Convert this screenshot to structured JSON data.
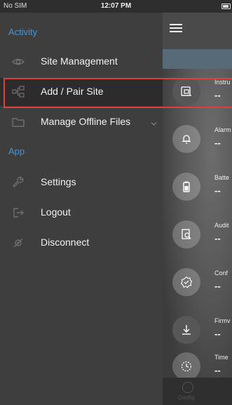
{
  "status_bar": {
    "carrier": "No SIM",
    "time": "12:07 PM"
  },
  "drawer": {
    "sections": [
      {
        "title": "Activity",
        "items": [
          {
            "label": "Site Management",
            "icon": "eye-icon"
          },
          {
            "label": "Add / Pair Site",
            "icon": "pair-site-icon"
          },
          {
            "label": "Manage Offline Files",
            "icon": "folder-icon"
          }
        ]
      },
      {
        "title": "App",
        "items": [
          {
            "label": "Settings",
            "icon": "wrench-icon"
          },
          {
            "label": "Logout",
            "icon": "logout-icon"
          },
          {
            "label": "Disconnect",
            "icon": "disconnect-icon"
          }
        ]
      }
    ]
  },
  "main": {
    "tiles": [
      {
        "label": "Instru",
        "value": "--",
        "icon": "instrument-icon"
      },
      {
        "label": "Alarm",
        "value": "--",
        "icon": "alarm-bell-icon"
      },
      {
        "label": "Batte",
        "value": "--",
        "icon": "battery-icon"
      },
      {
        "label": "Audit",
        "value": "--",
        "icon": "audit-icon"
      },
      {
        "label": "Conf",
        "value": "--",
        "icon": "config-gear-icon"
      },
      {
        "label": "Firmv",
        "value": "--",
        "icon": "download-icon"
      },
      {
        "label": "Time",
        "value": "--",
        "icon": "timer-icon"
      }
    ],
    "bottom_tab": {
      "label": "Config"
    }
  },
  "colors": {
    "accent": "#3f97de",
    "selection_border": "#e0403a",
    "drawer_bg": "#3e3e3e"
  }
}
